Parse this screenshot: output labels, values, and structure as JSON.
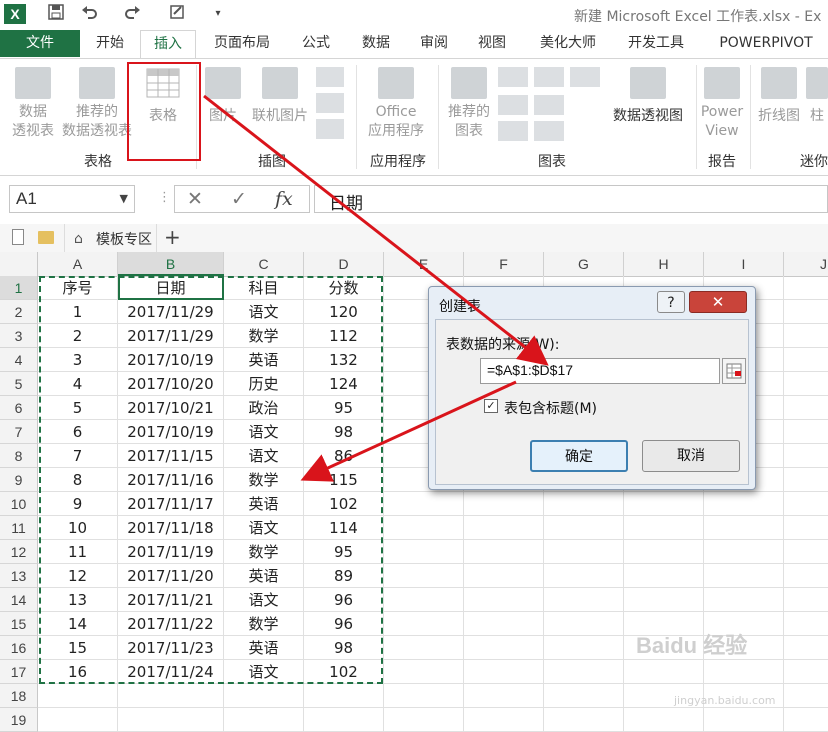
{
  "window": {
    "title": "新建 Microsoft Excel 工作表.xlsx - Ex",
    "logo_text": "X"
  },
  "quick_access": {
    "save_icon": "save-icon",
    "undo_icon": "undo-icon",
    "redo_icon": "redo-icon"
  },
  "tabs": [
    {
      "label": "文件"
    },
    {
      "label": "开始"
    },
    {
      "label": "插入"
    },
    {
      "label": "页面布局"
    },
    {
      "label": "公式"
    },
    {
      "label": "数据"
    },
    {
      "label": "审阅"
    },
    {
      "label": "视图"
    },
    {
      "label": "美化大师"
    },
    {
      "label": "开发工具"
    },
    {
      "label": "POWERPIVOT"
    }
  ],
  "ribbon": {
    "pivot_table": {
      "line1": "数据",
      "line2": "透视表"
    },
    "recommended_pivot": {
      "line1": "推荐的",
      "line2": "数据透视表"
    },
    "table": {
      "label": "表格"
    },
    "picture": {
      "label": "图片"
    },
    "online_picture": {
      "label": "联机图片"
    },
    "office_apps": {
      "line1": "Office",
      "line2": "应用程序"
    },
    "recommended_charts": {
      "line1": "推荐的",
      "line2": "图表"
    },
    "pivot_chart": {
      "label": "数据透视图"
    },
    "power_view": {
      "line1": "Power",
      "line2": "View"
    },
    "sparkline_line": {
      "label": "折线图"
    },
    "sparkline_col": {
      "label": "柱"
    },
    "groups": {
      "tables": "表格",
      "illustrations": "插图",
      "apps": "应用程序",
      "charts": "图表",
      "reports": "报告",
      "sparklines": "迷你"
    }
  },
  "formula_bar": {
    "name_box": "A1",
    "cancel": "✕",
    "enter": "✓",
    "fx": "fx",
    "value": "日期"
  },
  "sheet_bar": {
    "template_label": "模板专区",
    "add": "+"
  },
  "columns": [
    "A",
    "B",
    "C",
    "D",
    "E",
    "F",
    "G",
    "H",
    "I",
    "J"
  ],
  "rows": [
    {
      "num": "1",
      "a": "序号",
      "b": "日期",
      "c": "科目",
      "d": "分数"
    },
    {
      "num": "2",
      "a": "1",
      "b": "2017/11/29",
      "c": "语文",
      "d": "120"
    },
    {
      "num": "3",
      "a": "2",
      "b": "2017/11/29",
      "c": "数学",
      "d": "112"
    },
    {
      "num": "4",
      "a": "3",
      "b": "2017/10/19",
      "c": "英语",
      "d": "132"
    },
    {
      "num": "5",
      "a": "4",
      "b": "2017/10/20",
      "c": "历史",
      "d": "124"
    },
    {
      "num": "6",
      "a": "5",
      "b": "2017/10/21",
      "c": "政治",
      "d": "95"
    },
    {
      "num": "7",
      "a": "6",
      "b": "2017/10/19",
      "c": "语文",
      "d": "98"
    },
    {
      "num": "8",
      "a": "7",
      "b": "2017/11/15",
      "c": "语文",
      "d": "86"
    },
    {
      "num": "9",
      "a": "8",
      "b": "2017/11/16",
      "c": "数学",
      "d": "115"
    },
    {
      "num": "10",
      "a": "9",
      "b": "2017/11/17",
      "c": "英语",
      "d": "102"
    },
    {
      "num": "11",
      "a": "10",
      "b": "2017/11/18",
      "c": "语文",
      "d": "114"
    },
    {
      "num": "12",
      "a": "11",
      "b": "2017/11/19",
      "c": "数学",
      "d": "95"
    },
    {
      "num": "13",
      "a": "12",
      "b": "2017/11/20",
      "c": "英语",
      "d": "89"
    },
    {
      "num": "14",
      "a": "13",
      "b": "2017/11/21",
      "c": "语文",
      "d": "96"
    },
    {
      "num": "15",
      "a": "14",
      "b": "2017/11/22",
      "c": "数学",
      "d": "96"
    },
    {
      "num": "16",
      "a": "15",
      "b": "2017/11/23",
      "c": "英语",
      "d": "98"
    },
    {
      "num": "17",
      "a": "16",
      "b": "2017/11/24",
      "c": "语文",
      "d": "102"
    },
    {
      "num": "18",
      "a": "",
      "b": "",
      "c": "",
      "d": ""
    },
    {
      "num": "19",
      "a": "",
      "b": "",
      "c": "",
      "d": ""
    }
  ],
  "dialog": {
    "title": "创建表",
    "help": "?",
    "close": "✕",
    "source_label": "表数据的来源(W):",
    "range": "=$A$1:$D$17",
    "has_headers_label": "表包含标题(M)",
    "has_headers_checked": true,
    "check_mark": "✓",
    "ok": "确定",
    "cancel": "取消"
  },
  "watermark": {
    "brand": "Baidu 经验",
    "url": "jingyan.baidu.com"
  },
  "colors": {
    "excel_green": "#1f7244",
    "annotation_red": "#d9141b",
    "dialog_close": "#c9443a"
  }
}
